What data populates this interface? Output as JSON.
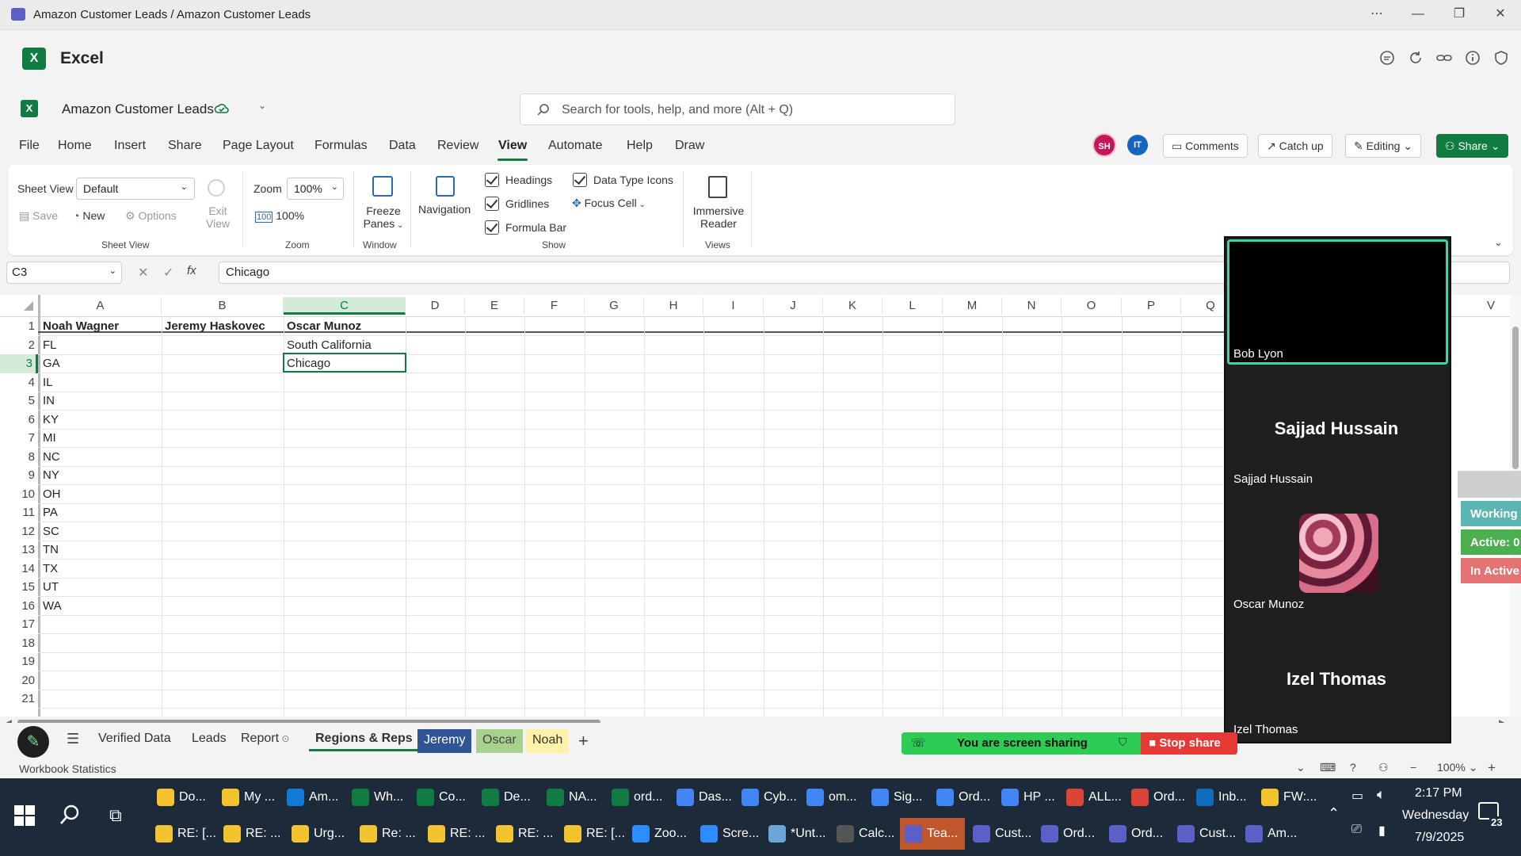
{
  "window": {
    "title": "Amazon Customer Leads / Amazon Customer Leads"
  },
  "app": {
    "name": "Excel",
    "doc_name": "Amazon Customer Leads"
  },
  "search": {
    "placeholder": "Search for tools, help, and more (Alt + Q)"
  },
  "menu": [
    "File",
    "Home",
    "Insert",
    "Share",
    "Page Layout",
    "Formulas",
    "Data",
    "Review",
    "View",
    "Automate",
    "Help",
    "Draw"
  ],
  "menu_active": "View",
  "header": {
    "avatars": [
      {
        "initials": "SH",
        "color": "#c2185b"
      },
      {
        "initials": "IT",
        "color": "#1565c0"
      }
    ],
    "comments": "Comments",
    "catchup": "Catch up",
    "editing": "Editing",
    "share": "Share"
  },
  "ribbon": {
    "sheetview_label": "Sheet View",
    "sheetview_value": "Default",
    "save": "Save",
    "new": "New",
    "options": "Options",
    "exit_view": [
      "Exit",
      "View"
    ],
    "group_sheetview": "Sheet View",
    "zoom_label": "Zoom",
    "zoom_value": "100%",
    "zoom100": "100%",
    "group_zoom": "Zoom",
    "freeze": [
      "Freeze",
      "Panes"
    ],
    "group_window": "Window",
    "navigation": "Navigation",
    "headings": "Headings",
    "gridlines": "Gridlines",
    "formula_bar": "Formula Bar",
    "data_type_icons": "Data Type Icons",
    "focus_cell": "Focus Cell",
    "group_show": "Show",
    "immersive": [
      "Immersive",
      "Reader"
    ],
    "group_views": "Views"
  },
  "formula": {
    "cell": "C3",
    "value": "Chicago"
  },
  "columns": [
    "A",
    "B",
    "C",
    "D",
    "E",
    "F",
    "G",
    "H",
    "I",
    "J",
    "K",
    "L",
    "M",
    "N",
    "O",
    "P",
    "Q",
    "V"
  ],
  "rows": [
    {
      "n": "1",
      "a": "Noah Wagner",
      "b": "Jeremy Haskovec",
      "c": "Oscar Munoz"
    },
    {
      "n": "2",
      "a": "FL",
      "b": "",
      "c": "South California"
    },
    {
      "n": "3",
      "a": "GA",
      "b": "",
      "c": "Chicago"
    },
    {
      "n": "4",
      "a": "IL",
      "b": "",
      "c": ""
    },
    {
      "n": "5",
      "a": "IN",
      "b": "",
      "c": ""
    },
    {
      "n": "6",
      "a": "KY",
      "b": "",
      "c": ""
    },
    {
      "n": "7",
      "a": "MI",
      "b": "",
      "c": ""
    },
    {
      "n": "8",
      "a": "NC",
      "b": "",
      "c": ""
    },
    {
      "n": "9",
      "a": "NY",
      "b": "",
      "c": ""
    },
    {
      "n": "10",
      "a": "OH",
      "b": "",
      "c": ""
    },
    {
      "n": "11",
      "a": "PA",
      "b": "",
      "c": ""
    },
    {
      "n": "12",
      "a": "SC",
      "b": "",
      "c": ""
    },
    {
      "n": "13",
      "a": "TN",
      "b": "",
      "c": ""
    },
    {
      "n": "14",
      "a": "TX",
      "b": "",
      "c": ""
    },
    {
      "n": "15",
      "a": "UT",
      "b": "",
      "c": ""
    },
    {
      "n": "16",
      "a": "WA",
      "b": "",
      "c": ""
    },
    {
      "n": "17",
      "a": "",
      "b": "",
      "c": ""
    },
    {
      "n": "18",
      "a": "",
      "b": "",
      "c": ""
    },
    {
      "n": "19",
      "a": "",
      "b": "",
      "c": ""
    },
    {
      "n": "20",
      "a": "",
      "b": "",
      "c": ""
    },
    {
      "n": "21",
      "a": "",
      "b": "",
      "c": ""
    }
  ],
  "sheets": [
    {
      "name": "Verified Data",
      "bg": ""
    },
    {
      "name": "Leads",
      "bg": ""
    },
    {
      "name": "Report",
      "bg": ""
    },
    {
      "name": "Regions & Reps",
      "bg": "",
      "active": true
    },
    {
      "name": "Jeremy",
      "bg": "#2f5597",
      "fg": "#ffffff"
    },
    {
      "name": "Oscar",
      "bg": "#a9d18e",
      "fg": "#333333"
    },
    {
      "name": "Noah",
      "bg": "#fff2a8",
      "fg": "#333333"
    }
  ],
  "status": {
    "left": "Workbook Statistics",
    "zoom": "100%"
  },
  "participants": [
    {
      "name": "Bob Lyon"
    },
    {
      "name": "Sajjad Hussain",
      "big": "Sajjad Hussain"
    },
    {
      "name": "Oscar Munoz"
    },
    {
      "name": "Izel Thomas",
      "big": "Izel Thomas"
    }
  ],
  "side_badges": [
    {
      "label": "Working",
      "color": "#5bb5b0"
    },
    {
      "label": "Active: 0",
      "color": "#4caf50"
    },
    {
      "label": "In Active",
      "color": "#e57373"
    }
  ],
  "share": {
    "message": "You are screen sharing",
    "stop": "Stop share"
  },
  "taskbar": {
    "row1": [
      {
        "label": "Do...",
        "color": "#f4c430"
      },
      {
        "label": "My ...",
        "color": "#f4c430"
      },
      {
        "label": "Am...",
        "color": "#0f7bd6"
      },
      {
        "label": "Wh...",
        "color": "#107c41"
      },
      {
        "label": "Co...",
        "color": "#107c41"
      },
      {
        "label": "De...",
        "color": "#107c41"
      },
      {
        "label": "NA...",
        "color": "#107c41"
      },
      {
        "label": "ord...",
        "color": "#107c41"
      },
      {
        "label": "Das...",
        "color": "#4285f4"
      },
      {
        "label": "Cyb...",
        "color": "#4285f4"
      },
      {
        "label": "om...",
        "color": "#4285f4"
      },
      {
        "label": "Sig...",
        "color": "#4285f4"
      },
      {
        "label": "Ord...",
        "color": "#4285f4"
      },
      {
        "label": "HP ...",
        "color": "#4285f4"
      },
      {
        "label": "ALL...",
        "color": "#db4437"
      },
      {
        "label": "Ord...",
        "color": "#db4437"
      },
      {
        "label": "Inb...",
        "color": "#0f6cbd"
      },
      {
        "label": "FW:...",
        "color": "#f4c430"
      }
    ],
    "row2": [
      {
        "label": "RE: [...",
        "color": "#f4c430"
      },
      {
        "label": "RE: ...",
        "color": "#f4c430"
      },
      {
        "label": "Urg...",
        "color": "#f4c430"
      },
      {
        "label": "Re: ...",
        "color": "#f4c430"
      },
      {
        "label": "RE: ...",
        "color": "#f4c430"
      },
      {
        "label": "RE: ...",
        "color": "#f4c430"
      },
      {
        "label": "RE: [...",
        "color": "#f4c430"
      },
      {
        "label": "Zoo...",
        "color": "#2d8cff"
      },
      {
        "label": "Scre...",
        "color": "#2d8cff"
      },
      {
        "label": "*Unt...",
        "color": "#6aa6d8"
      },
      {
        "label": "Calc...",
        "color": "#555555"
      },
      {
        "label": "Tea...",
        "color": "#5b5fc7",
        "highlight": true
      },
      {
        "label": "Cust...",
        "color": "#5b5fc7"
      },
      {
        "label": "Ord...",
        "color": "#5b5fc7"
      },
      {
        "label": "Ord...",
        "color": "#5b5fc7"
      },
      {
        "label": "Cust...",
        "color": "#5b5fc7"
      },
      {
        "label": "Am...",
        "color": "#5b5fc7"
      }
    ],
    "time": "2:17 PM",
    "day": "Wednesday",
    "date": "7/9/2025",
    "notif": "23"
  }
}
